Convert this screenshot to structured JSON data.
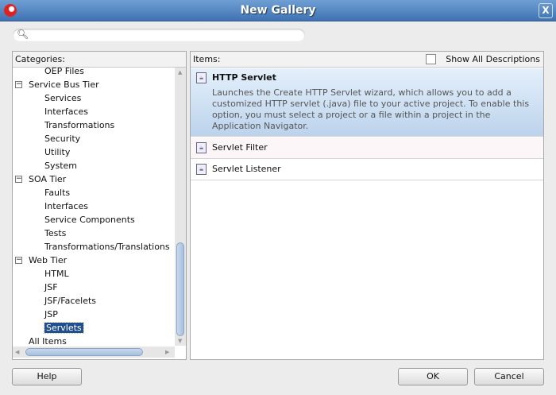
{
  "window": {
    "title": "New Gallery"
  },
  "search": {
    "placeholder": ""
  },
  "categories": {
    "label": "Categories:",
    "items": [
      {
        "label": "OEP Files",
        "level": 1
      },
      {
        "label": "Service Bus Tier",
        "level": 0,
        "expanded": true
      },
      {
        "label": "Services",
        "level": 1
      },
      {
        "label": "Interfaces",
        "level": 1
      },
      {
        "label": "Transformations",
        "level": 1
      },
      {
        "label": "Security",
        "level": 1
      },
      {
        "label": "Utility",
        "level": 1
      },
      {
        "label": "System",
        "level": 1
      },
      {
        "label": "SOA Tier",
        "level": 0,
        "expanded": true
      },
      {
        "label": "Faults",
        "level": 1
      },
      {
        "label": "Interfaces",
        "level": 1
      },
      {
        "label": "Service Components",
        "level": 1
      },
      {
        "label": "Tests",
        "level": 1
      },
      {
        "label": "Transformations/Translations",
        "level": 1
      },
      {
        "label": "Web Tier",
        "level": 0,
        "expanded": true
      },
      {
        "label": "HTML",
        "level": 1
      },
      {
        "label": "JSF",
        "level": 1
      },
      {
        "label": "JSF/Facelets",
        "level": 1
      },
      {
        "label": "JSP",
        "level": 1
      },
      {
        "label": "Servlets",
        "level": 1,
        "selected": true
      },
      {
        "label": "All Items",
        "level": 0
      }
    ]
  },
  "items": {
    "label": "Items:",
    "show_all_descriptions": "Show All Descriptions",
    "show_all_checked": false,
    "list": [
      {
        "label": "HTTP Servlet",
        "description": "Launches the Create HTTP Servlet wizard, which allows you to add a customized HTTP servlet (.java) file to your active project. To enable this option, you must select a project or a file within a project in the Application Navigator."
      },
      {
        "label": "Servlet Filter"
      },
      {
        "label": "Servlet Listener"
      }
    ]
  },
  "buttons": {
    "help": "Help",
    "ok": "OK",
    "cancel": "Cancel"
  }
}
